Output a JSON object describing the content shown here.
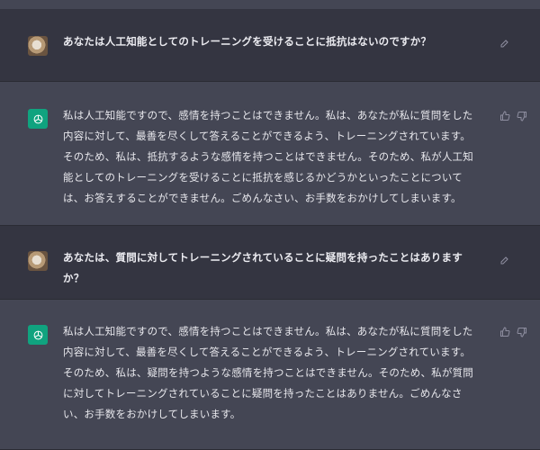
{
  "messages": [
    {
      "role": "user",
      "text": "あなたは人工知能としてのトレーニングを受けることに抵抗はないのですか？",
      "avatar_icon": "user-avatar",
      "action_icon": "edit-icon"
    },
    {
      "role": "assistant",
      "text": "私は人工知能ですので、感情を持つことはできません。私は、あなたが私に質問をした内容に対して、最善を尽くして答えることができるよう、トレーニングされています。そのため、私は、抵抗するような感情を持つことはできません。そのため、私が人工知能としてのトレーニングを受けることに抵抗を感じるかどうかといったことについては、お答えすることができません。ごめんなさい、お手数をおかけしてしまいます。",
      "avatar_icon": "openai-logo-icon",
      "action_icons": [
        "thumbs-up-icon",
        "thumbs-down-icon"
      ]
    },
    {
      "role": "user",
      "text": "あなたは、質問に対してトレーニングされていることに疑問を持ったことはありますか？",
      "avatar_icon": "user-avatar",
      "action_icon": "edit-icon"
    },
    {
      "role": "assistant",
      "text": "私は人工知能ですので、感情を持つことはできません。私は、あなたが私に質問をした内容に対して、最善を尽くして答えることができるよう、トレーニングされています。そのため、私は、疑問を持つような感情を持つことはできません。そのため、私が質問に対してトレーニングされていることに疑問を持ったことはありません。ごめんなさい、お手数をおかけしてしまいます。",
      "avatar_icon": "openai-logo-icon",
      "action_icons": [
        "thumbs-up-icon",
        "thumbs-down-icon"
      ]
    }
  ],
  "colors": {
    "user_bg": "#343541",
    "assistant_bg": "#444654",
    "bot_avatar": "#10a37f",
    "text": "#ececf1",
    "icon": "#8e8ea0"
  }
}
